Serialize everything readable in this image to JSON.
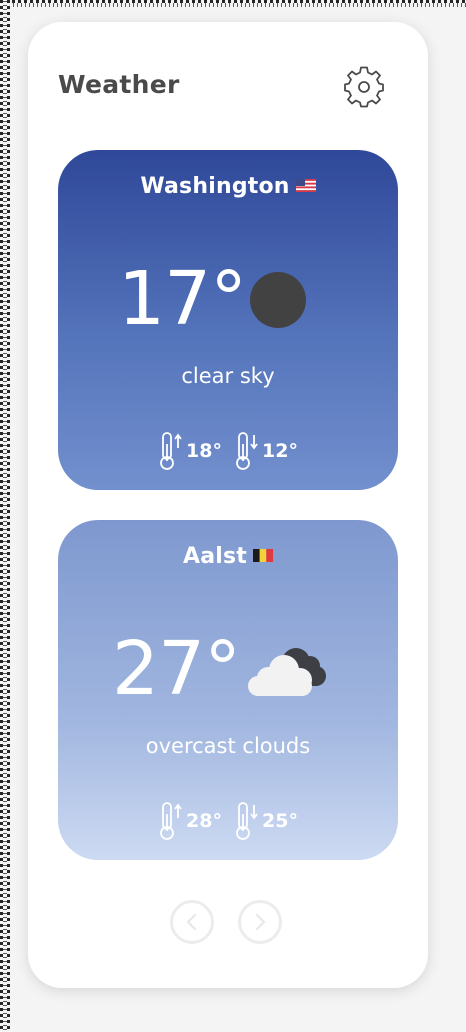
{
  "app": {
    "title": "Weather"
  },
  "cards": [
    {
      "city": "Washington",
      "flag": "us-flag",
      "temp": "17°",
      "icon": "clear-sky-icon",
      "description": "clear sky",
      "max": "18°",
      "min": "12°"
    },
    {
      "city": "Aalst",
      "flag": "belgium-flag",
      "temp": "27°",
      "icon": "overcast-clouds-icon",
      "description": "overcast clouds",
      "max": "28°",
      "min": "25°"
    }
  ],
  "nav": {
    "prev": "chevron-left-icon",
    "next": "chevron-right-icon"
  },
  "colors": {
    "card1_top": "#2f4899",
    "card1_bottom": "#7390ce",
    "card2_top": "#7e98cf",
    "card2_bottom": "#cddaf2",
    "title": "#4a4a4a"
  }
}
